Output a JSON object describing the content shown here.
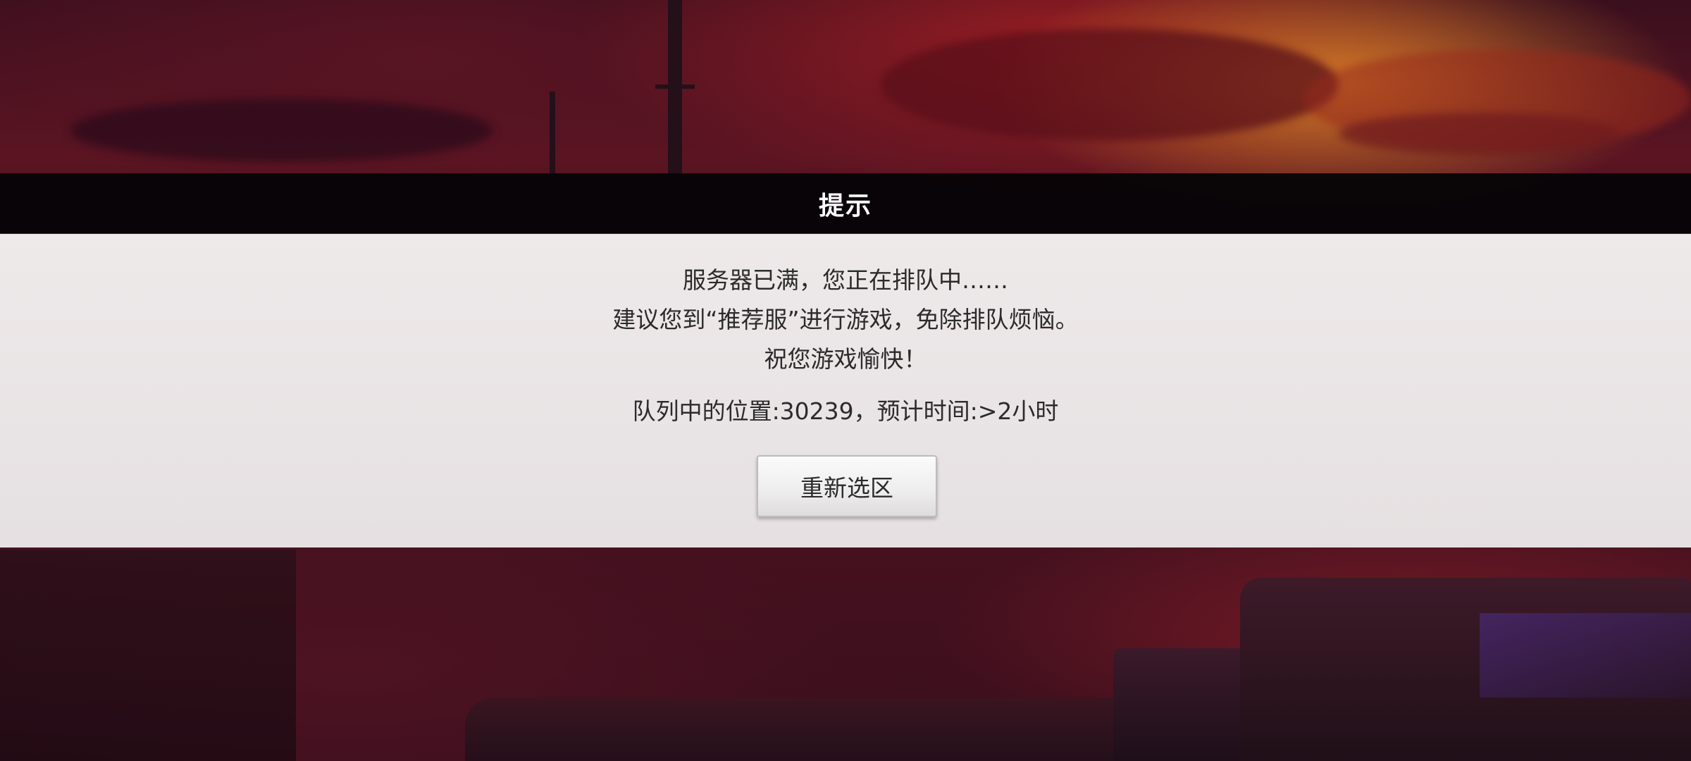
{
  "dialog": {
    "title": "提示",
    "message_line1": "服务器已满，您正在排队中……",
    "message_line2": "建议您到“推荐服”进行游戏，免除排队烦恼。",
    "message_line3": "祝您游戏愉快！",
    "queue_status": "队列中的位置:30239，预计时间:>2小时",
    "reselect_label": "重新选区"
  },
  "colors": {
    "title_bar": "#060406",
    "dialog_body": "#f3f0f0",
    "text": "#2b2b2b",
    "sky_accent": "#e68c28",
    "background": "#4a1220"
  }
}
